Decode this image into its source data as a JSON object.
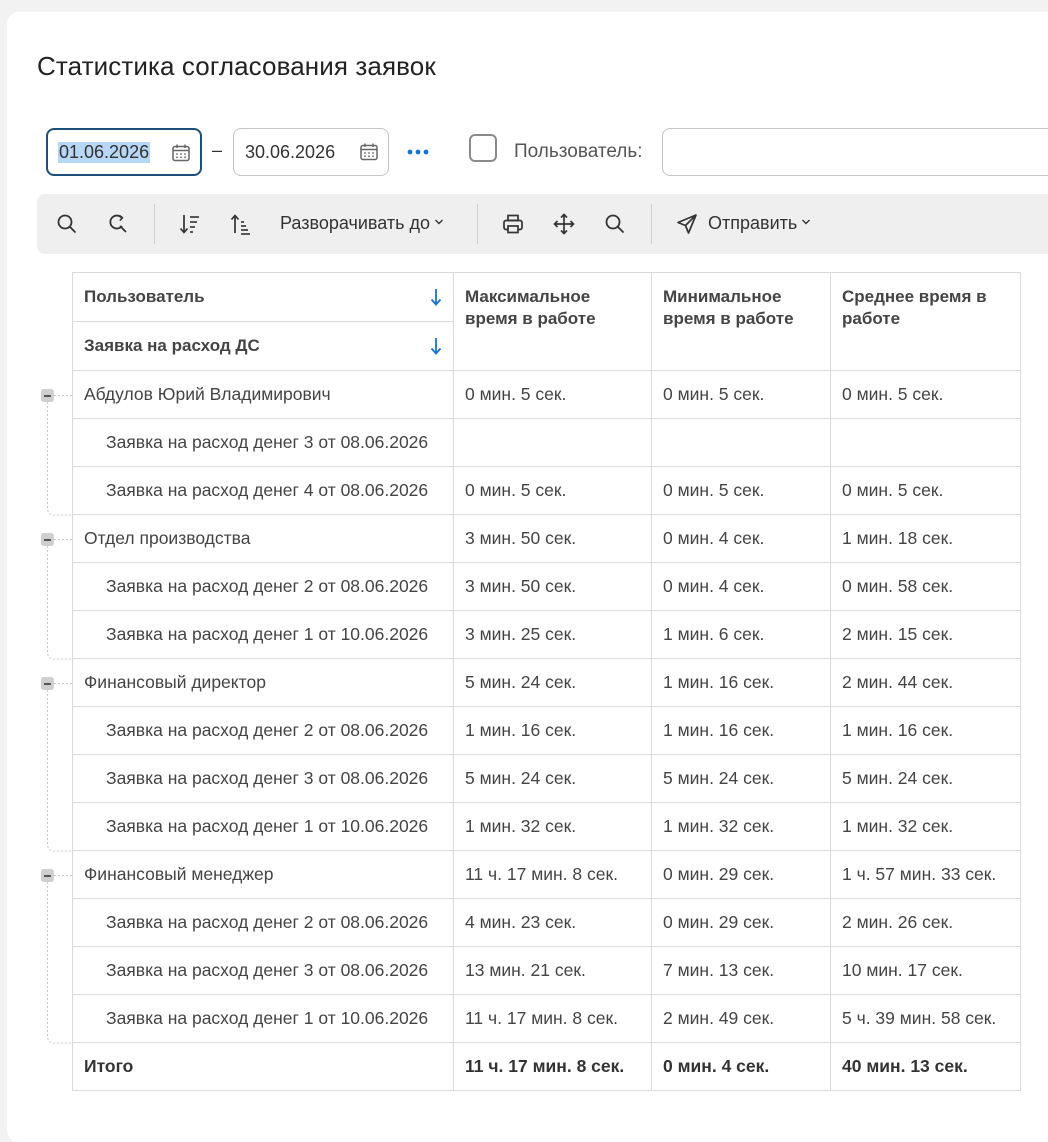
{
  "page_title": "Статистика согласования заявок",
  "filters": {
    "date_from": "01.06.2026",
    "date_to": "30.06.2026",
    "dash": "–",
    "user_label": "Пользователь:",
    "user_value": ""
  },
  "toolbar": {
    "expand_label": "Разворачивать до",
    "send_label": "Отправить"
  },
  "table": {
    "headers": {
      "user": "Пользователь",
      "request": "Заявка на расход ДС",
      "max": "Максимальное время в работе",
      "min": "Минимальное время в работе",
      "avg": "Среднее время в работе"
    },
    "groups": [
      {
        "name": "Абдулов Юрий Владимирович",
        "max": "0 мин. 5 сек.",
        "min": "0 мин. 5 сек.",
        "avg": "0 мин. 5 сек.",
        "rows": [
          {
            "name": "Заявка на расход денег 3 от 08.06.2026",
            "max": "",
            "min": "",
            "avg": ""
          },
          {
            "name": "Заявка на расход денег 4 от 08.06.2026",
            "max": "0 мин. 5 сек.",
            "min": "0 мин. 5 сек.",
            "avg": "0 мин. 5 сек."
          }
        ]
      },
      {
        "name": "Отдел производства",
        "max": "3 мин. 50 сек.",
        "min": "0 мин. 4 сек.",
        "avg": "1 мин. 18 сек.",
        "rows": [
          {
            "name": "Заявка на расход денег 2 от 08.06.2026",
            "max": "3 мин. 50 сек.",
            "min": "0 мин. 4 сек.",
            "avg": "0 мин. 58 сек."
          },
          {
            "name": "Заявка на расход денег 1 от 10.06.2026",
            "max": "3 мин. 25 сек.",
            "min": "1 мин. 6 сек.",
            "avg": "2 мин. 15 сек."
          }
        ]
      },
      {
        "name": "Финансовый директор",
        "max": "5 мин. 24 сек.",
        "min": "1 мин. 16 сек.",
        "avg": "2 мин. 44 сек.",
        "rows": [
          {
            "name": "Заявка на расход денег 2 от 08.06.2026",
            "max": "1 мин. 16 сек.",
            "min": "1 мин. 16 сек.",
            "avg": "1 мин. 16 сек."
          },
          {
            "name": "Заявка на расход денег 3 от 08.06.2026",
            "max": "5 мин. 24 сек.",
            "min": "5 мин. 24 сек.",
            "avg": "5 мин. 24 сек."
          },
          {
            "name": "Заявка на расход денег 1 от 10.06.2026",
            "max": "1 мин. 32 сек.",
            "min": "1 мин. 32 сек.",
            "avg": "1 мин. 32 сек."
          }
        ]
      },
      {
        "name": "Финансовый менеджер",
        "max": "11 ч. 17 мин. 8 сек.",
        "min": "0 мин. 29 сек.",
        "avg": "1 ч. 57 мин. 33 сек.",
        "rows": [
          {
            "name": "Заявка на расход денег 2 от 08.06.2026",
            "max": "4 мин. 23 сек.",
            "min": "0 мин. 29 сек.",
            "avg": "2 мин. 26 сек."
          },
          {
            "name": "Заявка на расход денег 3 от 08.06.2026",
            "max": "13 мин. 21 сек.",
            "min": "7 мин. 13 сек.",
            "avg": "10 мин. 17 сек."
          },
          {
            "name": "Заявка на расход денег 1 от 10.06.2026",
            "max": "11 ч. 17 мин. 8 сек.",
            "min": "2 мин. 49 сек.",
            "avg": "5 ч. 39 мин. 58 сек."
          }
        ]
      }
    ],
    "total": {
      "name": "Итого",
      "max": "11 ч. 17 мин. 8 сек.",
      "min": "0 мин. 4 сек.",
      "avg": "40 мин. 13 сек."
    }
  },
  "colors": {
    "accent": "#1a73c8",
    "focus_border": "#1f4e79",
    "selection": "#b8d6f5"
  }
}
